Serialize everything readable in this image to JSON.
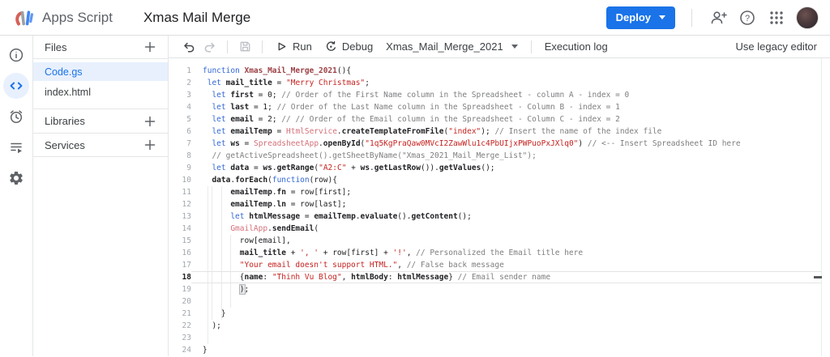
{
  "header": {
    "product": "Apps Script",
    "title": "Xmas Mail Merge",
    "deploy_label": "Deploy"
  },
  "colors": {
    "accent_blue": "#1a73e8",
    "active_file_bg": "#e8f0fe",
    "keyword": "#3367d6",
    "string": "#c5221f",
    "service": "#d4707a",
    "comment": "#7d7e80",
    "function_name": "#9c4145"
  },
  "files_panel": {
    "files_header": "Files",
    "items": [
      {
        "name": "Code.gs",
        "active": true
      },
      {
        "name": "index.html",
        "active": false
      }
    ],
    "libraries_label": "Libraries",
    "services_label": "Services"
  },
  "toolbar": {
    "run_label": "Run",
    "debug_label": "Debug",
    "function_selector": "Xmas_Mail_Merge_2021",
    "execution_log_label": "Execution log",
    "legacy_label": "Use legacy editor"
  },
  "editor": {
    "current_line": 18,
    "lines": [
      {
        "n": 1,
        "g": [],
        "s": [
          [
            "k",
            "function "
          ],
          [
            "f",
            "Xmas_Mail_Merge_2021"
          ],
          [
            "p",
            "(){"
          ]
        ]
      },
      {
        "n": 2,
        "g": [],
        "s": [
          [
            "p",
            " "
          ],
          [
            "k",
            "let "
          ],
          [
            "v",
            "mail_title"
          ],
          [
            "p",
            " = "
          ],
          [
            "s",
            "\"Merry Christmas\""
          ],
          [
            "p",
            ";"
          ]
        ]
      },
      {
        "n": 3,
        "g": [],
        "s": [
          [
            "p",
            "  "
          ],
          [
            "k",
            "let "
          ],
          [
            "v",
            "first"
          ],
          [
            "p",
            " = 0; "
          ],
          [
            "c",
            "// Order of the First Name column in the Spreadsheet - column A - index = 0"
          ]
        ]
      },
      {
        "n": 4,
        "g": [],
        "s": [
          [
            "p",
            "  "
          ],
          [
            "k",
            "let "
          ],
          [
            "v",
            "last"
          ],
          [
            "p",
            " = 1; "
          ],
          [
            "c",
            "// Order of the Last Name column in the Spreadsheet - Column B - index = 1"
          ]
        ]
      },
      {
        "n": 5,
        "g": [],
        "s": [
          [
            "p",
            "  "
          ],
          [
            "k",
            "let "
          ],
          [
            "v",
            "email"
          ],
          [
            "p",
            " = 2; "
          ],
          [
            "c",
            "// // Order of the Email column in the Spreadsheet - Column C - index = 2"
          ]
        ]
      },
      {
        "n": 6,
        "g": [],
        "s": [
          [
            "p",
            "  "
          ],
          [
            "k",
            "let "
          ],
          [
            "v",
            "emailTemp"
          ],
          [
            "p",
            " = "
          ],
          [
            "g2",
            "HtmlService"
          ],
          [
            "p",
            "."
          ],
          [
            "v",
            "createTemplateFromFile"
          ],
          [
            "p",
            "("
          ],
          [
            "s",
            "\"index\""
          ],
          [
            "p",
            "); "
          ],
          [
            "c",
            "// Insert the name of the index file"
          ]
        ]
      },
      {
        "n": 7,
        "g": [],
        "s": [
          [
            "p",
            "  "
          ],
          [
            "k",
            "let "
          ],
          [
            "v",
            "ws"
          ],
          [
            "p",
            " = "
          ],
          [
            "g2",
            "SpreadsheetApp"
          ],
          [
            "p",
            "."
          ],
          [
            "v",
            "openById"
          ],
          [
            "p",
            "("
          ],
          [
            "s",
            "\"1q5KgPraQaw0MVcI2ZawWlu1c4PbUIjxPWPuoPxJXlq0\""
          ],
          [
            "p",
            ") "
          ],
          [
            "c",
            "// <-- Insert Spreadsheet ID here"
          ]
        ]
      },
      {
        "n": 8,
        "g": [],
        "s": [
          [
            "p",
            "  "
          ],
          [
            "c",
            "// getActiveSpreadsheet().getSheetByName(\"Xmas_2021_Mail_Merge_List\");"
          ]
        ]
      },
      {
        "n": 9,
        "g": [],
        "s": [
          [
            "p",
            "  "
          ],
          [
            "k",
            "let "
          ],
          [
            "v",
            "data"
          ],
          [
            "p",
            " = "
          ],
          [
            "v",
            "ws"
          ],
          [
            "p",
            "."
          ],
          [
            "v",
            "getRange"
          ],
          [
            "p",
            "("
          ],
          [
            "s",
            "\"A2:C\""
          ],
          [
            "p",
            " + "
          ],
          [
            "v",
            "ws"
          ],
          [
            "p",
            "."
          ],
          [
            "v",
            "getLastRow"
          ],
          [
            "p",
            "())."
          ],
          [
            "v",
            "getValues"
          ],
          [
            "p",
            "();"
          ]
        ]
      },
      {
        "n": 10,
        "g": [],
        "s": [
          [
            "p",
            "  "
          ],
          [
            "v",
            "data"
          ],
          [
            "p",
            "."
          ],
          [
            "v",
            "forEach"
          ],
          [
            "p",
            "("
          ],
          [
            "k",
            "function"
          ],
          [
            "p",
            "(row){"
          ]
        ]
      },
      {
        "n": 11,
        "g": [
          1,
          2,
          4
        ],
        "s": [
          [
            "p",
            "      "
          ],
          [
            "v",
            "emailTemp"
          ],
          [
            "p",
            "."
          ],
          [
            "v",
            "fn"
          ],
          [
            "p",
            " = row[first];"
          ]
        ]
      },
      {
        "n": 12,
        "g": [
          1,
          2,
          4
        ],
        "s": [
          [
            "p",
            "      "
          ],
          [
            "v",
            "emailTemp"
          ],
          [
            "p",
            "."
          ],
          [
            "v",
            "ln"
          ],
          [
            "p",
            " = row[last];"
          ]
        ]
      },
      {
        "n": 13,
        "g": [
          1,
          2,
          4
        ],
        "s": [
          [
            "p",
            "      "
          ],
          [
            "k",
            "let "
          ],
          [
            "v",
            "htmlMessage"
          ],
          [
            "p",
            " = "
          ],
          [
            "v",
            "emailTemp"
          ],
          [
            "p",
            "."
          ],
          [
            "v",
            "evaluate"
          ],
          [
            "p",
            "()."
          ],
          [
            "v",
            "getContent"
          ],
          [
            "p",
            "();"
          ]
        ]
      },
      {
        "n": 14,
        "g": [
          1,
          2,
          4
        ],
        "s": [
          [
            "p",
            "      "
          ],
          [
            "g2",
            "GmailApp"
          ],
          [
            "p",
            "."
          ],
          [
            "v",
            "sendEmail"
          ],
          [
            "p",
            "("
          ]
        ]
      },
      {
        "n": 15,
        "g": [
          1,
          2,
          4,
          6
        ],
        "s": [
          [
            "p",
            "        row[email],"
          ]
        ]
      },
      {
        "n": 16,
        "g": [
          1,
          2,
          4,
          6
        ],
        "s": [
          [
            "p",
            "        "
          ],
          [
            "v",
            "mail_title"
          ],
          [
            "p",
            " + "
          ],
          [
            "s",
            "', '"
          ],
          [
            "p",
            " + row[first] + "
          ],
          [
            "s",
            "'!'"
          ],
          [
            "p",
            ", "
          ],
          [
            "c",
            "// Personalized the Email title here"
          ]
        ]
      },
      {
        "n": 17,
        "g": [
          1,
          2,
          4,
          6
        ],
        "s": [
          [
            "p",
            "        "
          ],
          [
            "s",
            "\"Your email doesn't support HTML.\""
          ],
          [
            "p",
            ", "
          ],
          [
            "c",
            "// False back message"
          ]
        ]
      },
      {
        "n": 18,
        "g": [
          1,
          2,
          4,
          6
        ],
        "s": [
          [
            "p",
            "        {"
          ],
          [
            "v",
            "name"
          ],
          [
            "p",
            ": "
          ],
          [
            "s",
            "\"Thinh Vu Blog\""
          ],
          [
            "p",
            ", "
          ],
          [
            "v",
            "htmlBody"
          ],
          [
            "p",
            ": "
          ],
          [
            "v",
            "htmlMessage"
          ],
          [
            "p",
            "} "
          ],
          [
            "c",
            "// Email sender name"
          ]
        ]
      },
      {
        "n": 19,
        "g": [
          1,
          2,
          4,
          6
        ],
        "s": [
          [
            "p",
            "        "
          ],
          [
            "b",
            ")"
          ],
          [
            "p",
            ";"
          ]
        ]
      },
      {
        "n": 20,
        "g": [
          1,
          2,
          4,
          6
        ],
        "s": []
      },
      {
        "n": 21,
        "g": [
          1,
          2,
          4
        ],
        "s": [
          [
            "p",
            "    }"
          ]
        ]
      },
      {
        "n": 22,
        "g": [
          1
        ],
        "s": [
          [
            "p",
            "  );"
          ]
        ]
      },
      {
        "n": 23,
        "g": [
          1
        ],
        "s": []
      },
      {
        "n": 24,
        "g": [],
        "s": [
          [
            "p",
            "}"
          ]
        ]
      }
    ]
  }
}
